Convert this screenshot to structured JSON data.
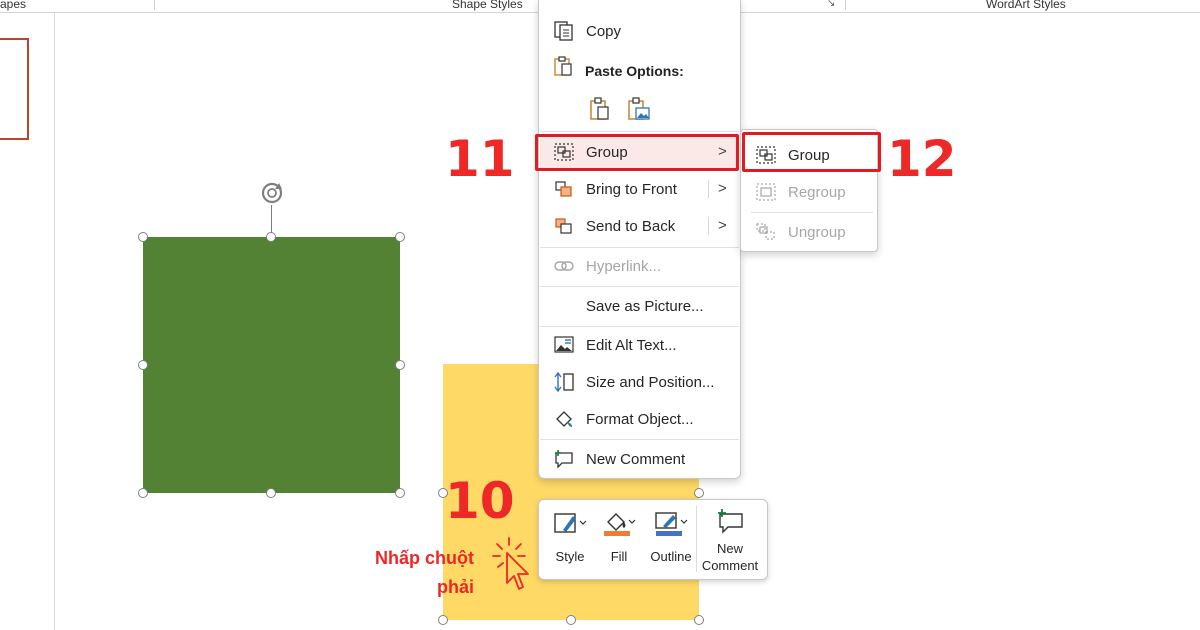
{
  "ribbon": {
    "groups": [
      "apes",
      "Shape Styles",
      "WordArt Styles"
    ]
  },
  "context_menu": {
    "copy": "Copy",
    "paste_options": "Paste Options:",
    "group": "Group",
    "bring_to_front": "Bring to Front",
    "send_to_back": "Send to Back",
    "hyperlink": "Hyperlink...",
    "save_as_picture": "Save as Picture...",
    "edit_alt_text": "Edit Alt Text...",
    "size_and_position": "Size and Position...",
    "format_object": "Format Object...",
    "new_comment": "New Comment"
  },
  "group_submenu": {
    "group": "Group",
    "regroup": "Regroup",
    "ungroup": "Ungroup"
  },
  "mini_toolbar": {
    "style": "Style",
    "fill": "Fill",
    "outline": "Outline",
    "new_comment_line1": "New",
    "new_comment_line2": "Comment"
  },
  "annotations": {
    "step_10": "10",
    "step_11": "11",
    "step_12": "12",
    "hint_line1": "Nhấp chuột",
    "hint_line2": "phải"
  },
  "colors": {
    "green_shape": "#548235",
    "yellow_shape": "#ffd966",
    "annotation_red": "#ee2727",
    "fill_swatch": "#ed7d31",
    "outline_swatch": "#4472c4"
  }
}
